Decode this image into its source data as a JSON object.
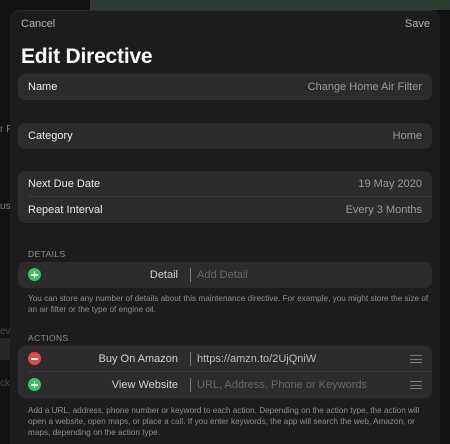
{
  "background": {
    "fragments": [
      "r F",
      "us",
      "ev",
      "ck"
    ]
  },
  "nav": {
    "cancel_label": "Cancel",
    "save_label": "Save"
  },
  "title": "Edit Directive",
  "name_row": {
    "label": "Name",
    "value": "Change Home Air Filter"
  },
  "category_row": {
    "label": "Category",
    "value": "Home"
  },
  "schedule": {
    "due_label": "Next Due Date",
    "due_value": "19 May 2020",
    "interval_label": "Repeat Interval",
    "interval_value": "Every 3 Months"
  },
  "details": {
    "header": "DETAILS",
    "row_label": "Detail",
    "placeholder": "Add Detail",
    "footer": "You can store any number of details about this maintenance directive. For example, you might store the size of an air filter or the type of engine oil."
  },
  "actions": {
    "header": "ACTIONS",
    "items": [
      {
        "label": "Buy On Amazon",
        "value": "https://amzn.to/2UjQniW"
      },
      {
        "label": "View Website",
        "placeholder": "URL, Address, Phone or Keywords"
      }
    ],
    "footer": "Add a URL, address, phone number or keyword to each action. Depending on the action type, the action will open a website, open maps, or place a call. If you enter keywords, the app will search the web, Amazon, or maps, depending on the action type."
  },
  "colors": {
    "sheet": "#1c1c1e",
    "cell": "#2c2c2e",
    "add": "#34c759",
    "remove": "#e84a44"
  }
}
